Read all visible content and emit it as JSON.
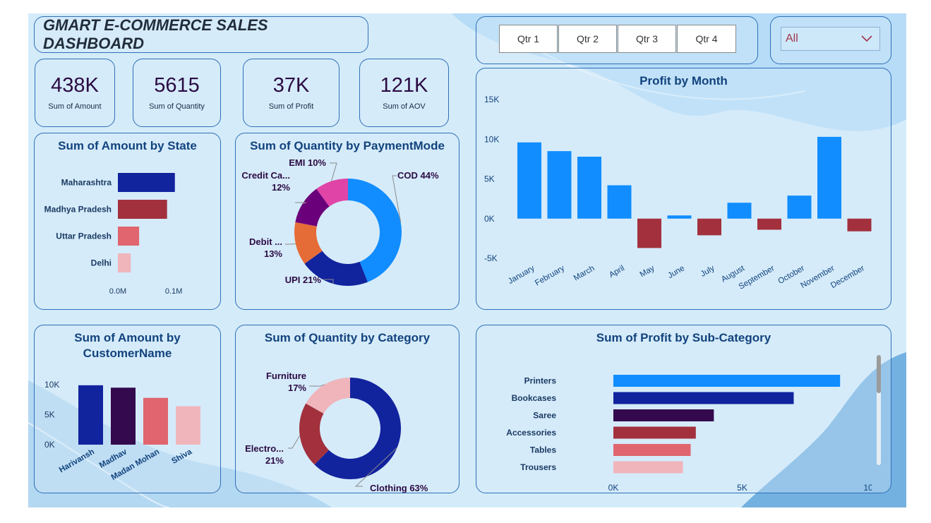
{
  "dashboard": {
    "title": "GMART  E-COMMERCE SALES DASHBOARD"
  },
  "slicers": {
    "quarters": [
      "Qtr 1",
      "Qtr 2",
      "Qtr 3",
      "Qtr 4"
    ],
    "dropdown_value": "All"
  },
  "kpis": [
    {
      "value": "438K",
      "label": "Sum of Amount"
    },
    {
      "value": "5615",
      "label": "Sum of Quantity"
    },
    {
      "value": "37K",
      "label": "Sum of Profit"
    },
    {
      "value": "121K",
      "label": "Sum of AOV"
    }
  ],
  "colors": {
    "blue": "#118dff",
    "navy": "#12239e",
    "darkpurple": "#34094d",
    "maroon": "#a2313d",
    "red": "#e0656e",
    "pink": "#f0b5bb",
    "orange": "#e66c37",
    "purple": "#6b007b",
    "magenta": "#e044a7",
    "title_text": "#12437d"
  },
  "chart_data": [
    {
      "id": "amount_by_state",
      "type": "bar",
      "orientation": "horizontal",
      "title": "Sum of Amount by State",
      "categories": [
        "Maharashtra",
        "Madhya Pradesh",
        "Uttar Pradesh",
        "Delhi"
      ],
      "values": [
        0.102,
        0.088,
        0.038,
        0.023
      ],
      "colors": [
        "#12239e",
        "#a2313d",
        "#e0656e",
        "#f0b5bb"
      ],
      "xlim": [
        0,
        0.12
      ],
      "xticks": [
        0,
        0.1
      ],
      "xtick_labels": [
        "0.0M",
        "0.1M"
      ]
    },
    {
      "id": "quantity_by_payment",
      "type": "pie",
      "donut": true,
      "title": "Sum of Quantity by PaymentMode",
      "slices": [
        {
          "label": "COD 44%",
          "value": 44,
          "color": "#118dff"
        },
        {
          "label": "UPI 21%",
          "value": 21,
          "color": "#12239e"
        },
        {
          "label": "Debit ...\n13%",
          "value": 13,
          "color": "#e66c37"
        },
        {
          "label": "Credit Ca...\n12%",
          "value": 12,
          "color": "#6b007b"
        },
        {
          "label": "EMI 10%",
          "value": 10,
          "color": "#e044a7"
        }
      ]
    },
    {
      "id": "profit_by_month",
      "type": "bar",
      "title": "Profit by Month",
      "categories": [
        "January",
        "February",
        "March",
        "April",
        "May",
        "June",
        "July",
        "August",
        "September",
        "October",
        "November",
        "December"
      ],
      "values": [
        9600,
        8500,
        7800,
        4200,
        -3700,
        400,
        -2100,
        2000,
        -1400,
        2900,
        10300,
        -1600
      ],
      "positive_color": "#118dff",
      "negative_color": "#a2313d",
      "ylim": [
        -5000,
        15000
      ],
      "yticks": [
        -5000,
        0,
        5000,
        10000,
        15000
      ],
      "ytick_labels": [
        "-5K",
        "0K",
        "5K",
        "10K",
        "15K"
      ]
    },
    {
      "id": "amount_by_customer",
      "type": "bar",
      "title": "Sum of Amount by CustomerName",
      "categories": [
        "Harivansh",
        "Madhav",
        "Madan Mohan",
        "Shiva"
      ],
      "values": [
        9900,
        9500,
        7800,
        6400
      ],
      "colors": [
        "#12239e",
        "#34094d",
        "#e0656e",
        "#f0b5bb"
      ],
      "ylim": [
        0,
        10000
      ],
      "yticks": [
        0,
        5000,
        10000
      ],
      "ytick_labels": [
        "0K",
        "5K",
        "10K"
      ]
    },
    {
      "id": "quantity_by_category",
      "type": "pie",
      "donut": true,
      "title": "Sum of Quantity by Category",
      "slices": [
        {
          "label": "Clothing 63%",
          "value": 63,
          "color": "#12239e"
        },
        {
          "label": "Electro...\n21%",
          "value": 21,
          "color": "#a2313d"
        },
        {
          "label": "Furniture\n17%",
          "value": 17,
          "color": "#f0b5bb"
        }
      ]
    },
    {
      "id": "profit_by_subcategory",
      "type": "bar",
      "orientation": "horizontal",
      "title": "Sum of Profit by Sub-Category",
      "categories": [
        "Printers",
        "Bookcases",
        "Saree",
        "Accessories",
        "Tables",
        "Trousers"
      ],
      "values": [
        8800,
        7000,
        3900,
        3200,
        3000,
        2700
      ],
      "colors": [
        "#118dff",
        "#12239e",
        "#34094d",
        "#a2313d",
        "#e0656e",
        "#f0b5bb"
      ],
      "xlim": [
        0,
        10000
      ],
      "xticks": [
        0,
        5000,
        10000
      ],
      "xtick_labels": [
        "0K",
        "5K",
        "10K"
      ]
    }
  ]
}
